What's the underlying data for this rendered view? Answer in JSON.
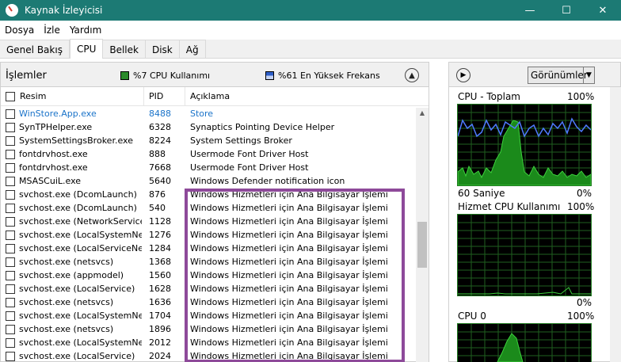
{
  "window": {
    "title": "Kaynak İzleyicisi",
    "controls": {
      "minimize": "—",
      "maximize": "☐",
      "close": "✕"
    }
  },
  "menu": [
    "Dosya",
    "İzle",
    "Yardım"
  ],
  "tabs": [
    {
      "label": "Genel Bakış",
      "active": false
    },
    {
      "label": "CPU",
      "active": true
    },
    {
      "label": "Bellek",
      "active": false
    },
    {
      "label": "Disk",
      "active": false
    },
    {
      "label": "Ağ",
      "active": false
    }
  ],
  "processes_panel": {
    "title": "İşlemler",
    "cpu_usage": "%7 CPU Kullanımı",
    "max_freq": "%61 En Yüksek Frekans",
    "collapse_icon": "chevron-up-icon",
    "columns": {
      "name": "Resim",
      "pid": "PID",
      "desc": "Açıklama"
    },
    "rows": [
      {
        "name": "WinStore.App.exe",
        "pid": "8488",
        "desc": "Store",
        "blue": true
      },
      {
        "name": "SynTPHelper.exe",
        "pid": "6328",
        "desc": "Synaptics Pointing Device Helper"
      },
      {
        "name": "SystemSettingsBroker.exe",
        "pid": "8224",
        "desc": "System Settings Broker"
      },
      {
        "name": "fontdrvhost.exe",
        "pid": "888",
        "desc": "Usermode Font Driver Host"
      },
      {
        "name": "fontdrvhost.exe",
        "pid": "7668",
        "desc": "Usermode Font Driver Host"
      },
      {
        "name": "MSASCuiL.exe",
        "pid": "5640",
        "desc": "Windows Defender notification icon"
      },
      {
        "name": "svchost.exe (DcomLaunch)",
        "pid": "876",
        "desc": "Windows Hizmetleri için Ana Bilgisayar İşlemi"
      },
      {
        "name": "svchost.exe (DcomLaunch)",
        "pid": "540",
        "desc": "Windows Hizmetleri için Ana Bilgisayar İşlemi"
      },
      {
        "name": "svchost.exe (NetworkService)",
        "pid": "1128",
        "desc": "Windows Hizmetleri için Ana Bilgisayar İşlemi"
      },
      {
        "name": "svchost.exe (LocalSystemNet...",
        "pid": "1276",
        "desc": "Windows Hizmetleri için Ana Bilgisayar İşlemi"
      },
      {
        "name": "svchost.exe (LocalServiceNet...",
        "pid": "1284",
        "desc": "Windows Hizmetleri için Ana Bilgisayar İşlemi"
      },
      {
        "name": "svchost.exe (netsvcs)",
        "pid": "1368",
        "desc": "Windows Hizmetleri için Ana Bilgisayar İşlemi"
      },
      {
        "name": "svchost.exe (appmodel)",
        "pid": "1560",
        "desc": "Windows Hizmetleri için Ana Bilgisayar İşlemi"
      },
      {
        "name": "svchost.exe (LocalService)",
        "pid": "1628",
        "desc": "Windows Hizmetleri için Ana Bilgisayar İşlemi"
      },
      {
        "name": "svchost.exe (netsvcs)",
        "pid": "1636",
        "desc": "Windows Hizmetleri için Ana Bilgisayar İşlemi"
      },
      {
        "name": "svchost.exe (LocalSystemNet...",
        "pid": "1704",
        "desc": "Windows Hizmetleri için Ana Bilgisayar İşlemi"
      },
      {
        "name": "svchost.exe (netsvcs)",
        "pid": "1896",
        "desc": "Windows Hizmetleri için Ana Bilgisayar İşlemi"
      },
      {
        "name": "svchost.exe (LocalSystemNet...",
        "pid": "2012",
        "desc": "Windows Hizmetleri için Ana Bilgisayar İşlemi"
      },
      {
        "name": "svchost.exe (LocalService)",
        "pid": "2024",
        "desc": "Windows Hizmetleri için Ana Bilgisayar İşlemi"
      }
    ]
  },
  "graphs_panel": {
    "nav_icon": "chevron-right-icon",
    "view_label": "Görünümler",
    "graphs": [
      {
        "title": "CPU - Toplam",
        "max": "100%",
        "time_label": "60 Saniye",
        "min": "0%"
      },
      {
        "title": "Hizmet CPU Kullanımı",
        "max": "100%",
        "min": "0%"
      },
      {
        "title": "CPU 0",
        "max": "100%"
      }
    ]
  },
  "colors": {
    "titlebar": "#1c7a74",
    "highlight": "#8e4a9a",
    "link_blue": "#1a73c9",
    "graph_green": "#3cd13c",
    "graph_blue": "#4f7bff"
  }
}
